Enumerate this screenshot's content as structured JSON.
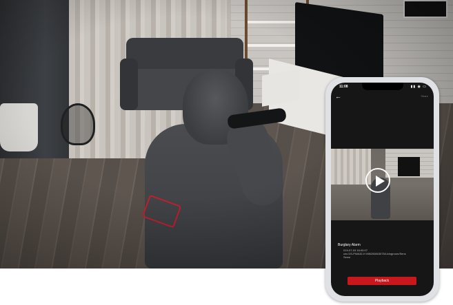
{
  "phone": {
    "status_time": "11:08",
    "status_icons": "▮▮ ◉ ▭",
    "nav_action": "Share",
    "alarm": {
      "title": "Burglary Alarm",
      "timestamp": "019-07-03 16:00:07",
      "detail": "ces DS-PWA32-H 098200843075/Livingroom/Sens",
      "status": "Sensi"
    },
    "play_button_label": "Playback"
  },
  "colors": {
    "accent": "#c8181e",
    "phone_frame": "#dfe1e4",
    "screen": "#161616"
  }
}
